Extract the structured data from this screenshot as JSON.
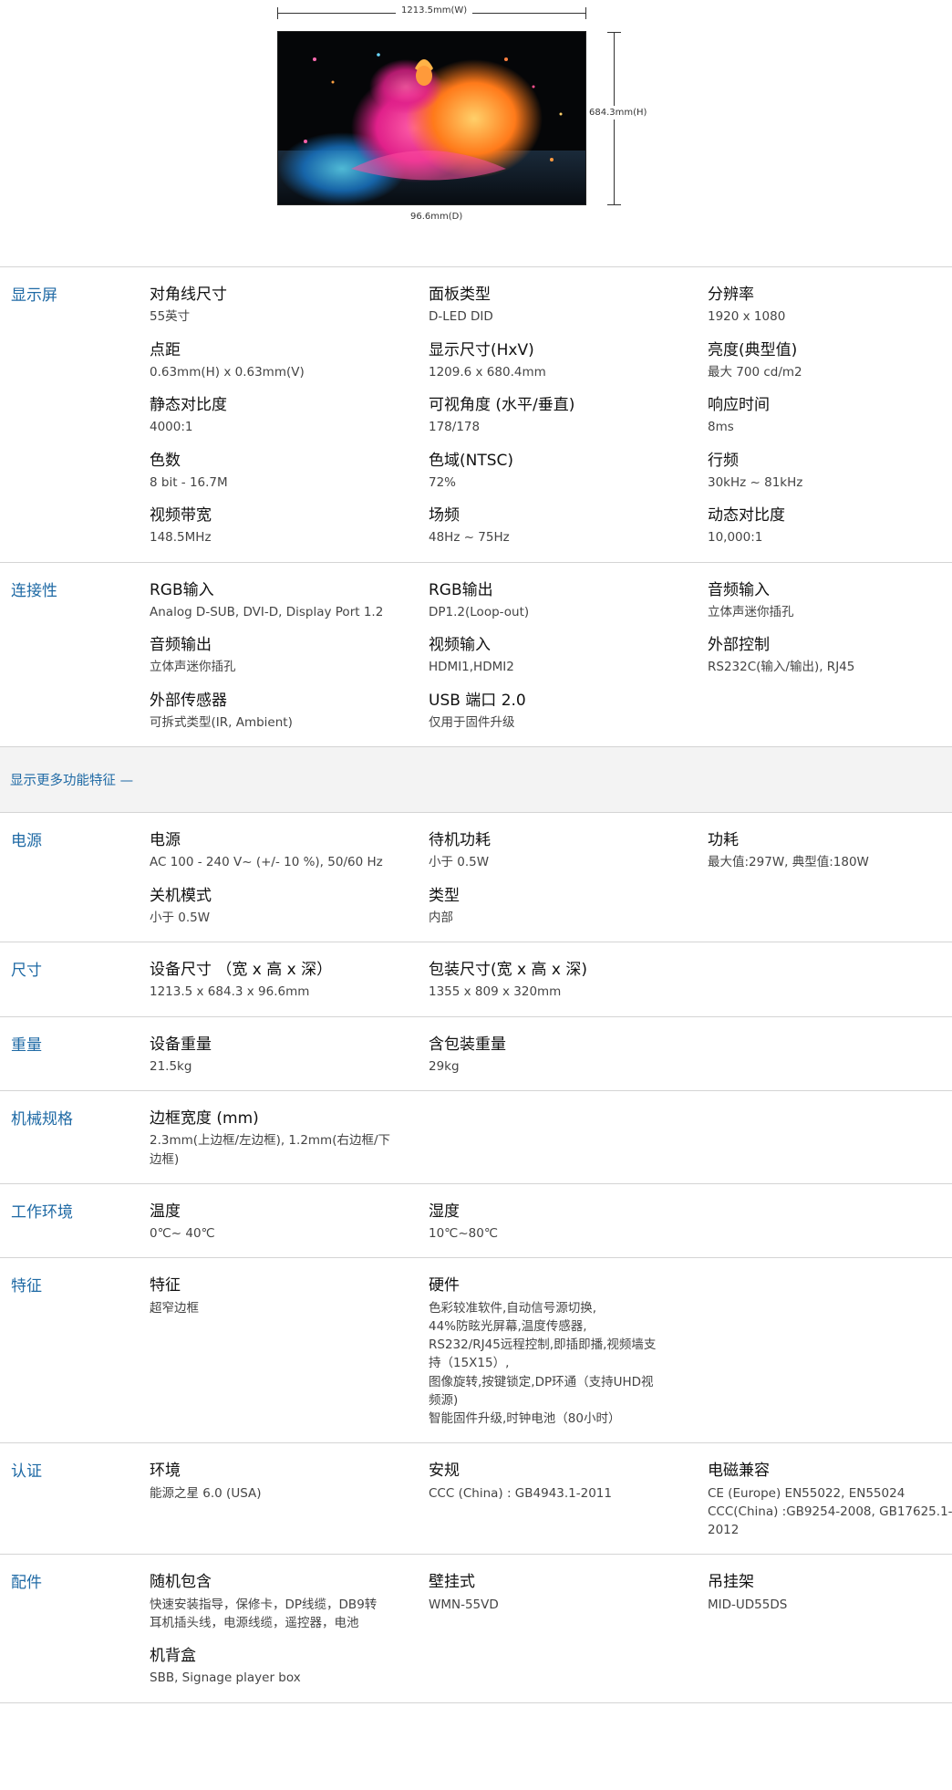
{
  "figure": {
    "width_label": "1213.5mm(W)",
    "height_label": "684.3mm(H)",
    "depth_label": "96.6mm(D)"
  },
  "more_features": {
    "label": "显示更多功能特征 —"
  },
  "sections_top": [
    {
      "title": "显示屏",
      "items": [
        {
          "label": "对角线尺寸",
          "value": "55英寸"
        },
        {
          "label": "面板类型",
          "value": "D-LED DID"
        },
        {
          "label": "分辨率",
          "value": "1920 x 1080"
        },
        {
          "label": "点距",
          "value": "0.63mm(H) x 0.63mm(V)"
        },
        {
          "label": "显示尺寸(HxV)",
          "value": "1209.6 x 680.4mm"
        },
        {
          "label": "亮度(典型值)",
          "value": "最大 700 cd/m2"
        },
        {
          "label": "静态对比度",
          "value": "4000:1"
        },
        {
          "label": "可视角度 (水平/垂直)",
          "value": "178/178"
        },
        {
          "label": "响应时间",
          "value": "8ms"
        },
        {
          "label": "色数",
          "value": "8 bit - 16.7M"
        },
        {
          "label": "色域(NTSC)",
          "value": "72%"
        },
        {
          "label": "行频",
          "value": "30kHz ~ 81kHz"
        },
        {
          "label": "视频带宽",
          "value": "148.5MHz"
        },
        {
          "label": "场频",
          "value": "48Hz ~ 75Hz"
        },
        {
          "label": "动态对比度",
          "value": "10,000:1"
        }
      ]
    },
    {
      "title": "连接性",
      "items": [
        {
          "label": "RGB输入",
          "value": "Analog D-SUB, DVI-D, Display Port 1.2"
        },
        {
          "label": "RGB输出",
          "value": "DP1.2(Loop-out)"
        },
        {
          "label": "音频输入",
          "value": "立体声迷你插孔"
        },
        {
          "label": "音频输出",
          "value": "立体声迷你插孔"
        },
        {
          "label": "视频输入",
          "value": "HDMI1,HDMI2"
        },
        {
          "label": "外部控制",
          "value": "RS232C(输入/输出), RJ45"
        },
        {
          "label": "外部传感器",
          "value": "可拆式类型(IR, Ambient)"
        },
        {
          "label": "USB 端口 2.0",
          "value": "仅用于固件升级"
        }
      ]
    }
  ],
  "sections_bottom": [
    {
      "title": "电源",
      "items": [
        {
          "label": "电源",
          "value": "AC 100 - 240 V~ (+/- 10 %), 50/60 Hz"
        },
        {
          "label": "待机功耗",
          "value": "小于 0.5W"
        },
        {
          "label": "功耗",
          "value": "最大值:297W, 典型值:180W"
        },
        {
          "label": "关机模式",
          "value": "小于 0.5W"
        },
        {
          "label": "类型",
          "value": "内部"
        }
      ]
    },
    {
      "title": "尺寸",
      "items": [
        {
          "label": "设备尺寸 （宽 x 高 x 深）",
          "value": "1213.5 x 684.3 x 96.6mm"
        },
        {
          "label": "包装尺寸(宽 x 高 x 深)",
          "value": "1355 x 809 x 320mm"
        }
      ]
    },
    {
      "title": "重量",
      "items": [
        {
          "label": "设备重量",
          "value": "21.5kg"
        },
        {
          "label": "含包装重量",
          "value": "29kg"
        }
      ]
    },
    {
      "title": "机械规格",
      "items": [
        {
          "label": "边框宽度 (mm)",
          "value": "2.3mm(上边框/左边框), 1.2mm(右边框/下\n边框)"
        }
      ]
    },
    {
      "title": "工作环境",
      "items": [
        {
          "label": "温度",
          "value": "0℃~ 40℃"
        },
        {
          "label": "湿度",
          "value": "10℃~80℃"
        }
      ]
    },
    {
      "title": "特征",
      "items": [
        {
          "label": "特征",
          "value": "超窄边框"
        },
        {
          "label": "硬件",
          "value": "色彩较准软件,自动信号源切换,\n44%防眩光屏幕,温度传感器,\nRS232/RJ45远程控制,即插即播,视频墙支\n持（15X15）,\n图像旋转,按键锁定,DP环通（支持UHD视\n频源)\n智能固件升级,时钟电池（80小时）"
        }
      ]
    },
    {
      "title": "认证",
      "items": [
        {
          "label": "环境",
          "value": "能源之星 6.0 (USA)"
        },
        {
          "label": "安规",
          "value": "CCC (China) : GB4943.1-2011"
        },
        {
          "label": "电磁兼容",
          "value": "CE (Europe) EN55022, EN55024\nCCC(China) :GB9254-2008, GB17625.1-\n2012"
        }
      ]
    },
    {
      "title": "配件",
      "items": [
        {
          "label": "随机包含",
          "value": "快速安装指导，保修卡，DP线缆，DB9转\n耳机插头线，电源线缆，遥控器，电池"
        },
        {
          "label": "壁挂式",
          "value": "WMN-55VD"
        },
        {
          "label": "吊挂架",
          "value": "MID-UD55DS"
        },
        {
          "label": "机背盒",
          "value": "SBB, Signage player box"
        }
      ]
    }
  ]
}
